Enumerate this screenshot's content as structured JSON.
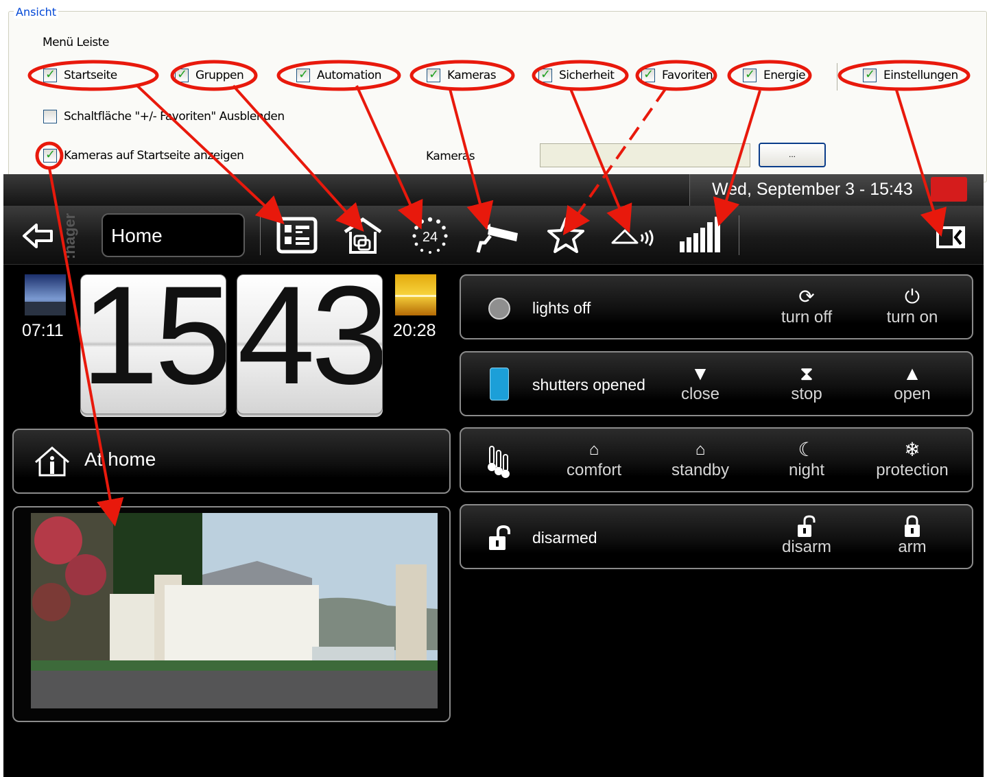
{
  "settings": {
    "legend": "Ansicht",
    "menu_label": "Menü Leiste",
    "menu_items": [
      {
        "label": "Startseite",
        "checked": true
      },
      {
        "label": "Gruppen",
        "checked": true
      },
      {
        "label": "Automation",
        "checked": true
      },
      {
        "label": "Kameras",
        "checked": true
      },
      {
        "label": "Sicherheit",
        "checked": true
      },
      {
        "label": "Favoriten",
        "checked": true
      },
      {
        "label": "Energie",
        "checked": true
      },
      {
        "label": "Einstellungen",
        "checked": true
      }
    ],
    "hide_fav_label": "Schaltfläche \"+/- Favoriten\" Ausblenden",
    "hide_fav_checked": false,
    "show_cameras_label": "Kameras auf Startseite anzeigen",
    "show_cameras_checked": true,
    "cameras_label": "Kameras",
    "cameras_value": "",
    "browse_button": "..."
  },
  "status": {
    "datetime": "Wed, September 3 - 15:43",
    "badge_color": "#d51c1c"
  },
  "nav": {
    "brand": ":hager",
    "home": "Home",
    "icons": [
      "back-arrow-icon",
      "startseite-list-icon",
      "groups-house-icon",
      "automation-24-icon",
      "camera-icon",
      "favorites-star-icon",
      "security-house-signal-icon",
      "energy-bars-icon",
      "settings-panel-icon"
    ],
    "automation_number": "24"
  },
  "clock": {
    "hours": "15",
    "minutes": "43",
    "sunrise": "07:11",
    "sunset": "20:28"
  },
  "presence": {
    "label": "At home"
  },
  "rows": [
    {
      "title": "lights off",
      "controls": [
        {
          "icon": "refresh-icon",
          "label": "turn off"
        },
        {
          "icon": "power-icon",
          "label": "turn on"
        }
      ]
    },
    {
      "title": "shutters opened",
      "controls": [
        {
          "icon": "triangle-down-icon",
          "label": "close"
        },
        {
          "icon": "hourglass-icon",
          "label": "stop"
        },
        {
          "icon": "triangle-up-icon",
          "label": "open"
        }
      ]
    },
    {
      "title": "",
      "controls": [
        {
          "icon": "house-comfort-icon",
          "label": "comfort"
        },
        {
          "icon": "house-standby-icon",
          "label": "standby"
        },
        {
          "icon": "moon-icon",
          "label": "night"
        },
        {
          "icon": "snowflake-icon",
          "label": "protection"
        }
      ]
    },
    {
      "title": "disarmed",
      "controls": [
        {
          "icon": "padlock-open-icon",
          "label": "disarm"
        },
        {
          "icon": "padlock-closed-icon",
          "label": "arm"
        }
      ]
    }
  ],
  "colors": {
    "annotation": "#e8190c",
    "accent_blue": "#1c9fd8",
    "checkbox_green": "#21a121",
    "legend_blue": "#0046d5"
  }
}
